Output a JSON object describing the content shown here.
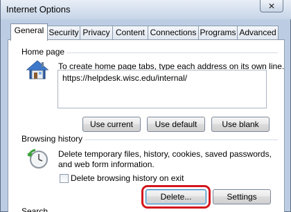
{
  "window": {
    "title": "Internet Options",
    "close_glyph": "✕"
  },
  "tabs": [
    {
      "label": "General",
      "active": true
    },
    {
      "label": "Security"
    },
    {
      "label": "Privacy"
    },
    {
      "label": "Content"
    },
    {
      "label": "Connections"
    },
    {
      "label": "Programs"
    },
    {
      "label": "Advanced"
    }
  ],
  "home_page": {
    "group_label": "Home page",
    "description": "To create home page tabs, type each address on its own line.",
    "url_value": "https://helpdesk.wisc.edu/internal/",
    "buttons": {
      "use_current": "Use current",
      "use_default": "Use default",
      "use_blank": "Use blank"
    },
    "icon": "house-icon"
  },
  "browsing_history": {
    "group_label": "Browsing history",
    "description_line1": "Delete temporary files, history, cookies, saved passwords,",
    "description_line2": "and web form information.",
    "checkbox_label": "Delete browsing history on exit",
    "checkbox_checked": false,
    "buttons": {
      "delete": "Delete...",
      "settings": "Settings"
    },
    "icon": "history-clock-icon"
  },
  "search": {
    "group_label": "Search"
  },
  "highlight_color": "#d4141c"
}
